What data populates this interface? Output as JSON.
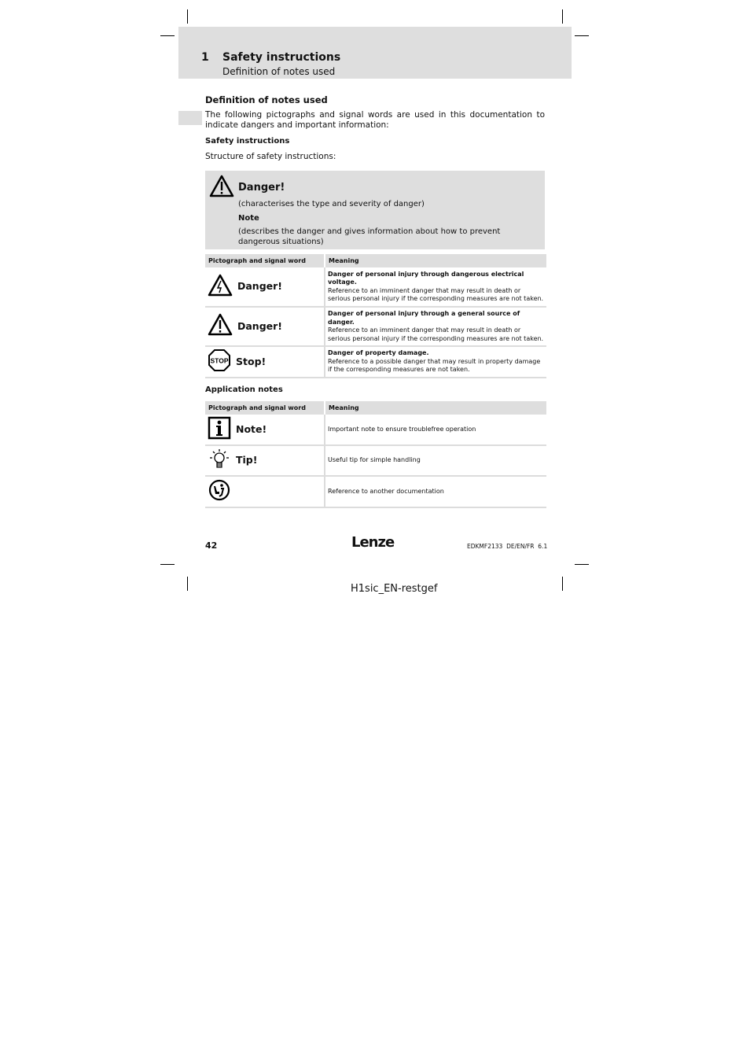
{
  "header": {
    "chapter_number": "1",
    "chapter_title": "Safety instructions",
    "chapter_subtitle": "Definition of notes used"
  },
  "section": {
    "title": "Definition of notes used",
    "intro": "The following pictographs and signal words are used in this documentation to indicate dangers and important information:",
    "safety_heading": "Safety instructions",
    "safety_structure": "Structure of safety instructions:"
  },
  "structure_box": {
    "icon": "warning-triangle-icon",
    "signal_word": "Danger!",
    "line1": "(characterises the type and severity of danger)",
    "note_label": "Note",
    "note_text": "(describes the danger and gives information about how to prevent dangerous situations)"
  },
  "safety_table": {
    "headers": [
      "Pictograph and signal word",
      "Meaning"
    ],
    "rows": [
      {
        "icon": "electrical-voltage-warning-icon",
        "signal": "Danger!",
        "title": "Danger of personal injury through dangerous electrical voltage.",
        "text": "Reference to an imminent danger that may result in death or serious personal injury if the corresponding measures are not taken."
      },
      {
        "icon": "general-warning-icon",
        "signal": "Danger!",
        "title": "Danger of personal injury through a general source of danger.",
        "text": "Reference to an imminent danger that may result in death or serious personal injury if the corresponding measures are not taken."
      },
      {
        "icon": "stop-icon",
        "signal": "Stop!",
        "title": "Danger of property damage.",
        "text": "Reference to a possible danger that may result in property damage if the corresponding measures are not taken."
      }
    ]
  },
  "application_notes": {
    "heading": "Application notes",
    "headers": [
      "Pictograph and signal word",
      "Meaning"
    ],
    "rows": [
      {
        "icon": "info-icon",
        "signal": "Note!",
        "text": "Important note to ensure troublefree operation"
      },
      {
        "icon": "lightbulb-icon",
        "signal": "Tip!",
        "text": "Useful tip for simple handling"
      },
      {
        "icon": "reference-icon",
        "signal": "",
        "text": "Reference to another documentation"
      }
    ]
  },
  "footer": {
    "page_number": "42",
    "logo": "Lenze",
    "doc_id": "EDKMF2133  DE/EN/FR  6.1",
    "job_name": "H1sic_EN-restgef"
  }
}
